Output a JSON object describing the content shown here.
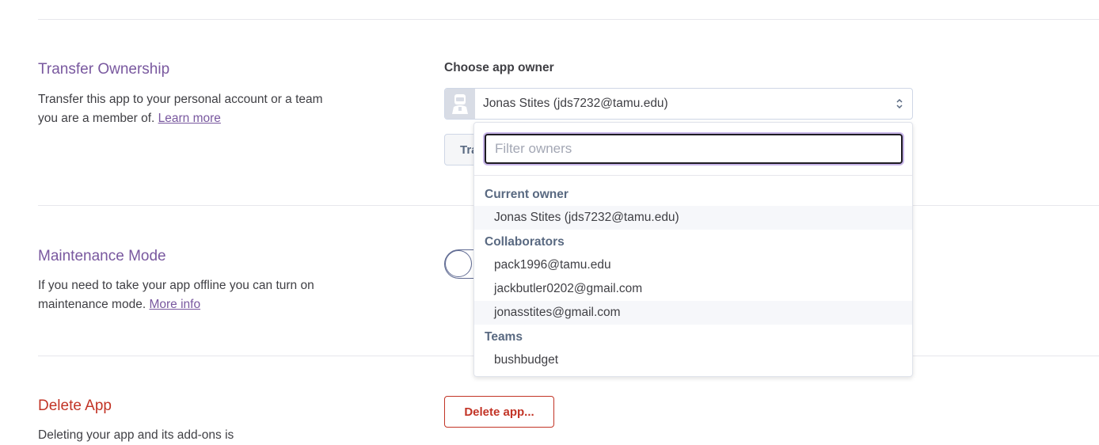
{
  "transfer": {
    "title": "Transfer Ownership",
    "desc": "Transfer this app to your personal account or a team you are a member of.",
    "learn_more": "Learn more",
    "choose_label": "Choose app owner",
    "selected_owner": "Jonas Stites (jds7232@tamu.edu)",
    "transfer_button": "Transfer"
  },
  "dropdown": {
    "filter_placeholder": "Filter owners",
    "current_owner_header": "Current owner",
    "current_owner": "Jonas Stites (jds7232@tamu.edu)",
    "collaborators_header": "Collaborators",
    "collaborators": [
      "pack1996@tamu.edu",
      "jackbutler0202@gmail.com",
      "jonasstites@gmail.com"
    ],
    "teams_header": "Teams",
    "teams": [
      "bushbudget"
    ]
  },
  "maintenance": {
    "title": "Maintenance Mode",
    "desc": "If you need to take your app offline you can turn on maintenance mode.",
    "more_info": "More info",
    "enabled": false
  },
  "delete": {
    "title": "Delete App",
    "desc": "Deleting your app and its add-ons is",
    "button": "Delete app..."
  },
  "colors": {
    "accent": "#79589f",
    "danger": "#c23426",
    "text": "#3f3f44"
  }
}
